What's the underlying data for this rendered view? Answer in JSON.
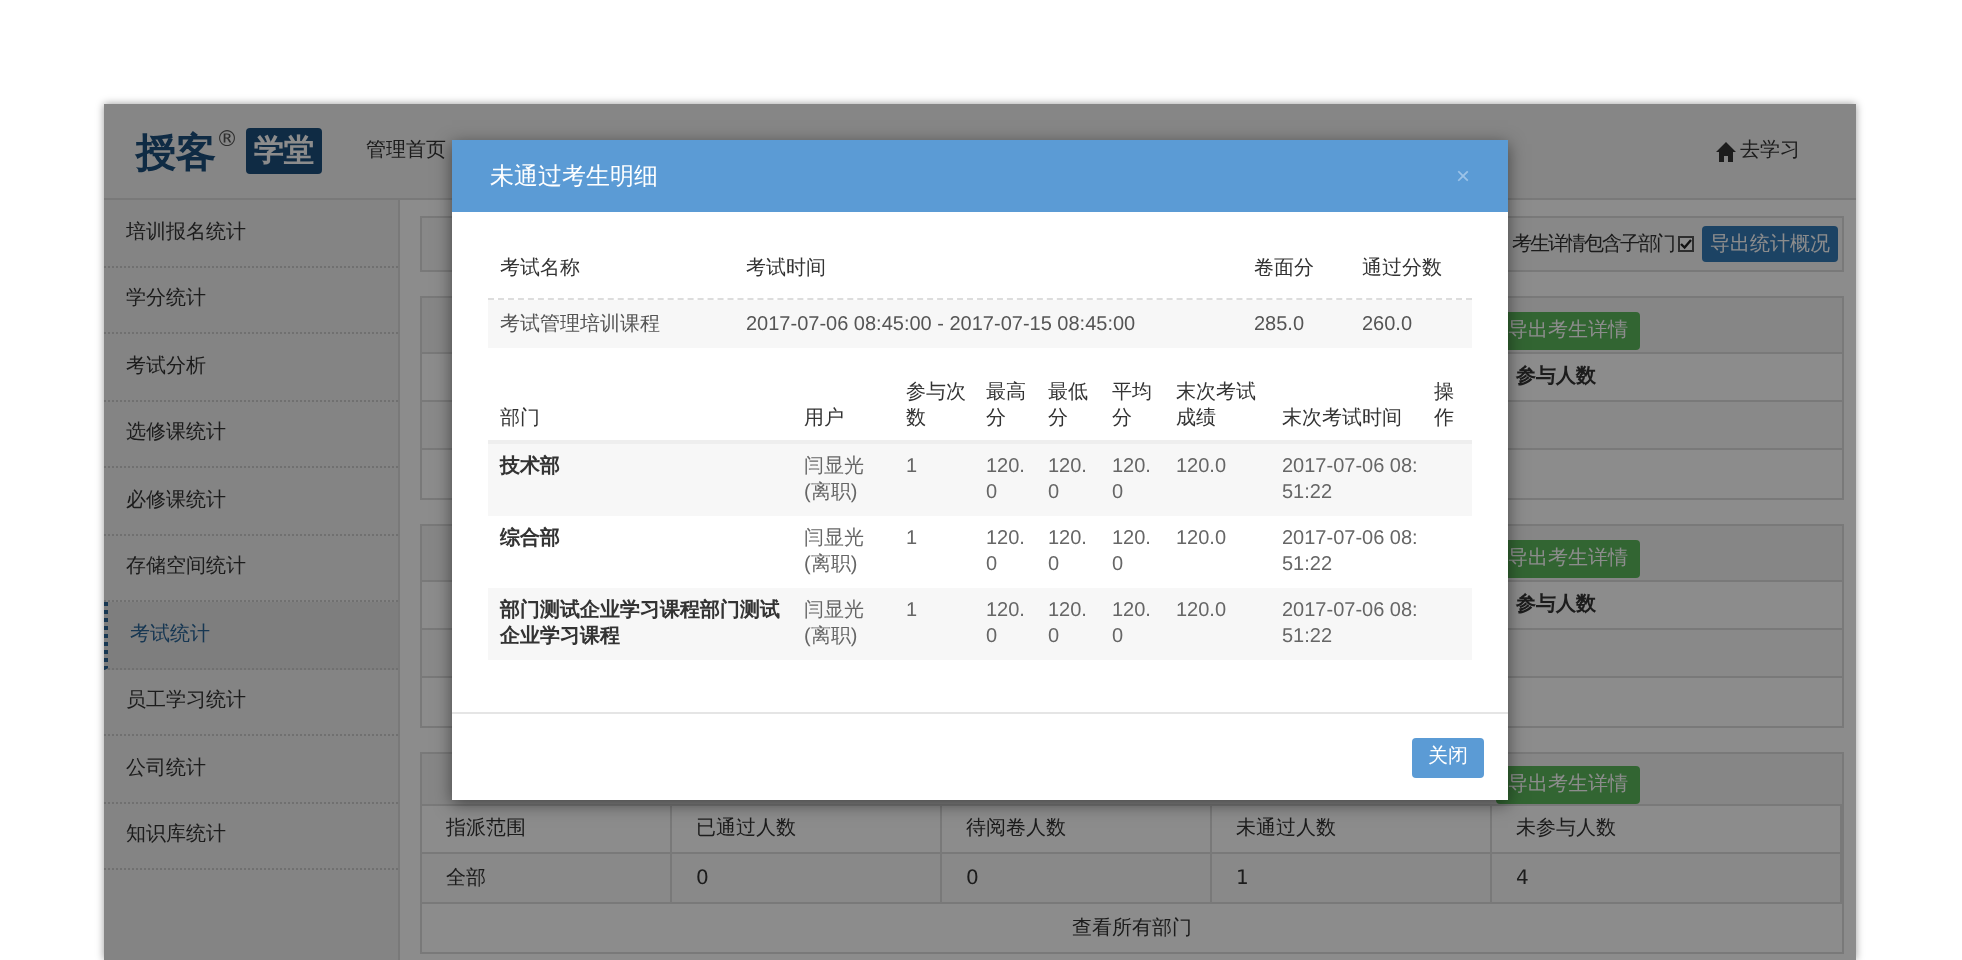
{
  "header": {
    "logo_text": "授客",
    "logo_mark": "®",
    "logo_badge": "学堂",
    "nav": [
      {
        "label": "管理首页"
      }
    ],
    "go_learn": "去学习"
  },
  "sidebar": {
    "items": [
      {
        "label": "培训报名统计",
        "selected": false
      },
      {
        "label": "学分统计",
        "selected": false
      },
      {
        "label": "考试分析",
        "selected": false
      },
      {
        "label": "选修课统计",
        "selected": false
      },
      {
        "label": "必修课统计",
        "selected": false
      },
      {
        "label": "存储空间统计",
        "selected": false
      },
      {
        "label": "考试统计",
        "selected": true
      },
      {
        "label": "员工学习统计",
        "selected": false
      },
      {
        "label": "公司统计",
        "selected": false
      },
      {
        "label": "知识库统计",
        "selected": false
      }
    ]
  },
  "toolbar": {
    "option_label": "考生详情包含子部门",
    "checked": true,
    "export_button": "导出统计概况"
  },
  "panels": [
    {
      "button": "导出考生详情",
      "column_label": "参与人数"
    },
    {
      "button": "导出考生详情",
      "column_label": "参与人数"
    }
  ],
  "summary_panel": {
    "button": "导出考生详情",
    "columns": [
      "指派范围",
      "已通过人数",
      "待阅卷人数",
      "未通过人数",
      "未参与人数"
    ],
    "row": [
      "全部",
      "0",
      "0",
      "1",
      "4"
    ],
    "footer_link": "查看所有部门"
  },
  "modal": {
    "title": "未通过考生明细",
    "close_icon": "×",
    "exam_table": {
      "columns": [
        "考试名称",
        "考试时间",
        "卷面分",
        "通过分数"
      ],
      "rows": [
        [
          "考试管理培训课程",
          "2017-07-06 08:45:00 - 2017-07-15 08:45:00",
          "285.0",
          "260.0"
        ]
      ]
    },
    "detail_table": {
      "columns": [
        "部门",
        "用户",
        "参与次数",
        "最高分",
        "最低分",
        "平均分",
        "末次考试成绩",
        "末次考试时间",
        "操作"
      ],
      "rows": [
        [
          "技术部",
          "闫显光(离职)",
          "1",
          "120.0",
          "120.0",
          "120.0",
          "120.0",
          "2017-07-06 08:51:22"
        ],
        [
          "综合部",
          "闫显光(离职)",
          "1",
          "120.0",
          "120.0",
          "120.0",
          "120.0",
          "2017-07-06 08:51:22"
        ],
        [
          "部门测试企业学习课程部门测试企业学习课程",
          "闫显光(离职)",
          "1",
          "120.0",
          "120.0",
          "120.0",
          "120.0",
          "2017-07-06 08:51:22"
        ]
      ]
    },
    "close_button": "关闭"
  }
}
